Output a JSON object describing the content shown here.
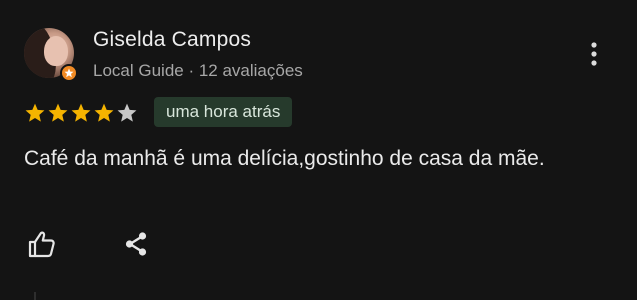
{
  "review": {
    "reviewer_name": "Giselda Campos",
    "reviewer_meta": "Local Guide · 12 avaliações",
    "rating": 4,
    "max_rating": 5,
    "time_ago": "uma hora atrás",
    "text": "Café da manhã é uma delícia,gostinho de casa da mãe."
  },
  "icons": {
    "more": "more-vert-icon",
    "like": "thumbs-up-icon",
    "share": "share-icon",
    "badge": "local-guide-badge-icon"
  },
  "colors": {
    "background": "#141414",
    "star_filled": "#f5b400",
    "star_empty": "#c8c8c8",
    "chip_background": "#263a2c",
    "badge": "#f08a24"
  }
}
